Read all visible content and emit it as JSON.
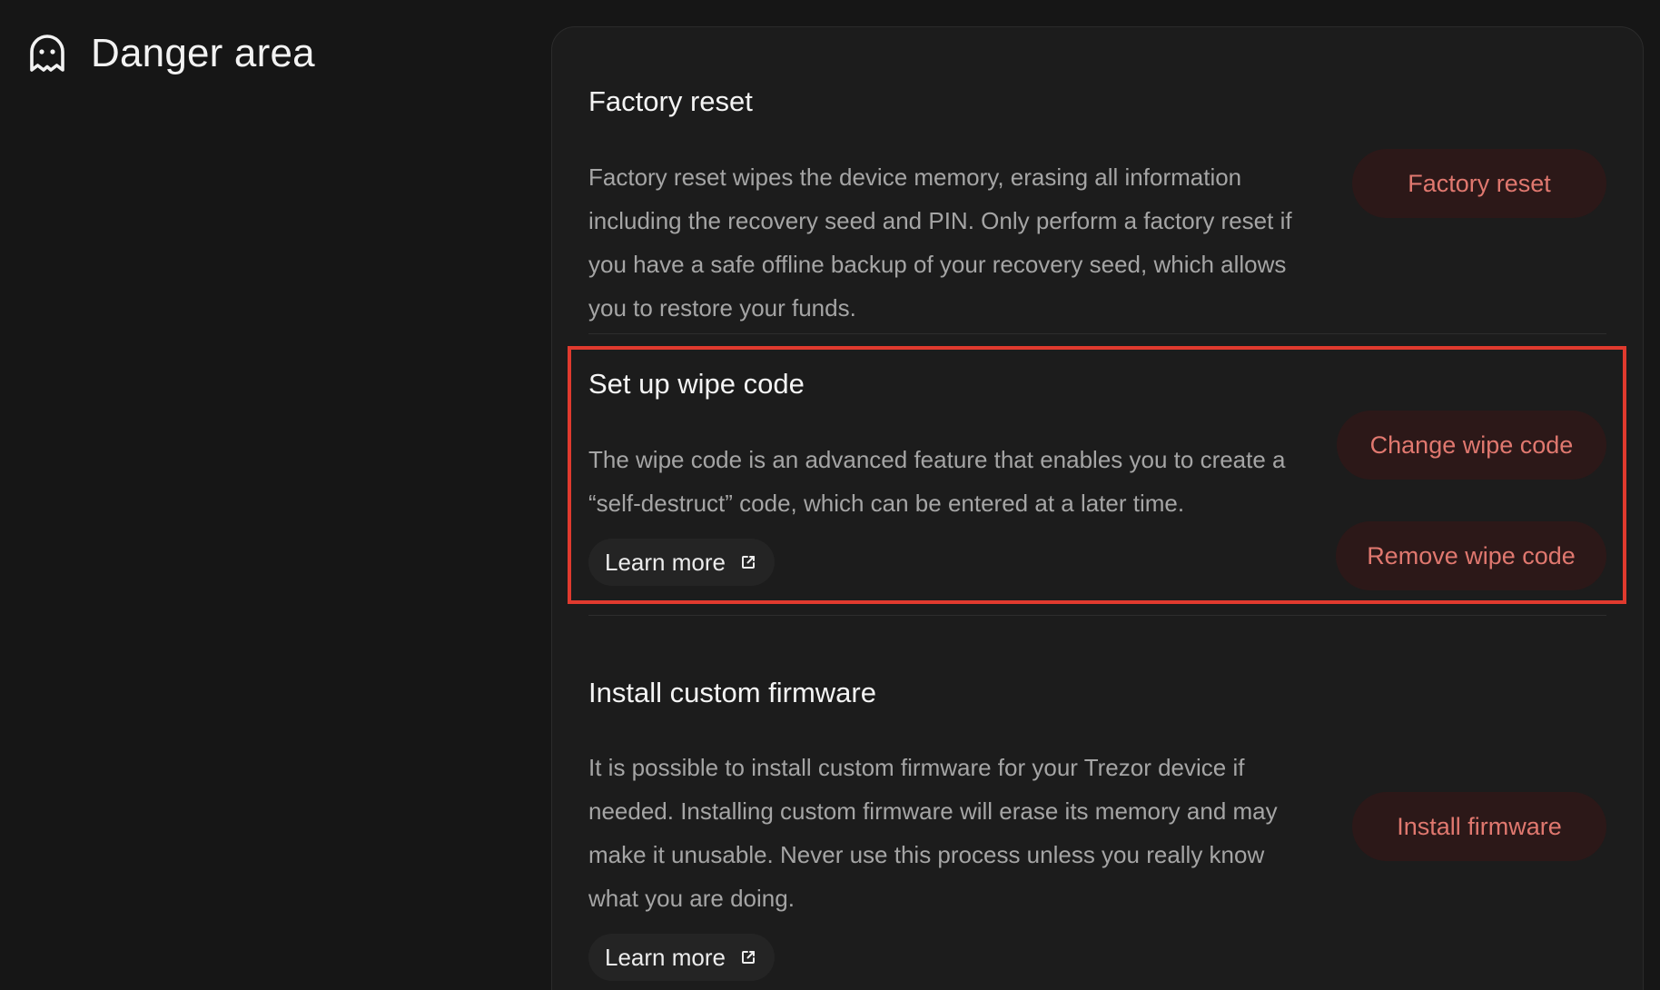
{
  "header": {
    "title": "Danger area",
    "icon": "ghost-icon"
  },
  "sections": {
    "factory_reset": {
      "title": "Factory reset",
      "description": "Factory reset wipes the device memory, erasing all information including the recovery seed and PIN. Only perform a factory reset if you have a safe offline backup of your recovery seed, which allows you to restore your funds.",
      "button_label": "Factory reset"
    },
    "wipe_code": {
      "title": "Set up wipe code",
      "description": "The wipe code is an advanced feature that enables you to create a “self-destruct” code, which can be entered at a later time.",
      "learn_more_label": "Learn more",
      "change_button_label": "Change wipe code",
      "remove_button_label": "Remove wipe code"
    },
    "custom_firmware": {
      "title": "Install custom firmware",
      "description": "It is possible to install custom firmware for your Trezor device if needed. Installing custom firmware will erase its memory and may make it unusable. Never use this process unless you really know what you are doing.",
      "learn_more_label": "Learn more",
      "button_label": "Install firmware"
    }
  },
  "colors": {
    "background": "#161616",
    "card": "#1c1c1c",
    "danger_text": "#e0786f",
    "danger_button_bg": "#2c1818",
    "highlight_border": "#e03a2e"
  }
}
